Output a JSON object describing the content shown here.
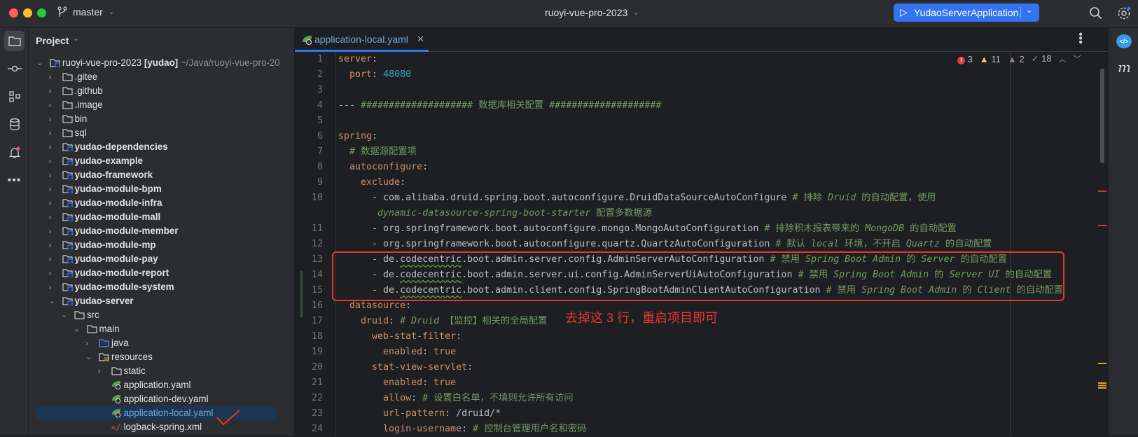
{
  "titlebar": {
    "branch": "master",
    "project": "ruoyi-vue-pro-2023",
    "run_config": "YudaoServerApplication"
  },
  "project_panel": {
    "title": "Project",
    "rows": [
      {
        "label": "ruoyi-vue-pro-2023",
        "suffix": "[yudao]",
        "path": "~/Java/ruoyi-vue-pro-20",
        "depth": 0,
        "chev": "down",
        "icon": "module"
      },
      {
        "label": ".gitee",
        "depth": 1,
        "chev": "right",
        "icon": "folder"
      },
      {
        "label": ".github",
        "depth": 1,
        "chev": "right",
        "icon": "folder"
      },
      {
        "label": ".image",
        "depth": 1,
        "chev": "right",
        "icon": "folder"
      },
      {
        "label": "bin",
        "depth": 1,
        "chev": "right",
        "icon": "folder"
      },
      {
        "label": "sql",
        "depth": 1,
        "chev": "right",
        "icon": "folder"
      },
      {
        "label": "yudao-dependencies",
        "depth": 1,
        "chev": "right",
        "icon": "module",
        "bold": true
      },
      {
        "label": "yudao-example",
        "depth": 1,
        "chev": "right",
        "icon": "module",
        "bold": true
      },
      {
        "label": "yudao-framework",
        "depth": 1,
        "chev": "right",
        "icon": "module",
        "bold": true
      },
      {
        "label": "yudao-module-bpm",
        "depth": 1,
        "chev": "right",
        "icon": "module",
        "bold": true
      },
      {
        "label": "yudao-module-infra",
        "depth": 1,
        "chev": "right",
        "icon": "module",
        "bold": true
      },
      {
        "label": "yudao-module-mall",
        "depth": 1,
        "chev": "right",
        "icon": "module",
        "bold": true
      },
      {
        "label": "yudao-module-member",
        "depth": 1,
        "chev": "right",
        "icon": "module",
        "bold": true
      },
      {
        "label": "yudao-module-mp",
        "depth": 1,
        "chev": "right",
        "icon": "module",
        "bold": true
      },
      {
        "label": "yudao-module-pay",
        "depth": 1,
        "chev": "right",
        "icon": "module",
        "bold": true
      },
      {
        "label": "yudao-module-report",
        "depth": 1,
        "chev": "right",
        "icon": "module",
        "bold": true
      },
      {
        "label": "yudao-module-system",
        "depth": 1,
        "chev": "right",
        "icon": "module",
        "bold": true
      },
      {
        "label": "yudao-server",
        "depth": 1,
        "chev": "down",
        "icon": "module",
        "bold": true
      },
      {
        "label": "src",
        "depth": 2,
        "chev": "down",
        "icon": "folder"
      },
      {
        "label": "main",
        "depth": 3,
        "chev": "down",
        "icon": "folder"
      },
      {
        "label": "java",
        "depth": 4,
        "chev": "right",
        "icon": "java-folder"
      },
      {
        "label": "resources",
        "depth": 4,
        "chev": "down",
        "icon": "resources-folder"
      },
      {
        "label": "static",
        "depth": 5,
        "chev": "right",
        "icon": "folder"
      },
      {
        "label": "application.yaml",
        "depth": 5,
        "icon": "yaml"
      },
      {
        "label": "application-dev.yaml",
        "depth": 5,
        "icon": "yaml"
      },
      {
        "label": "application-local.yaml",
        "depth": 5,
        "icon": "yaml",
        "selected": true
      },
      {
        "label": "logback-spring.xml",
        "depth": 5,
        "icon": "xml"
      }
    ]
  },
  "editor": {
    "tab": "application-local.yaml",
    "inspections": {
      "errors": "3",
      "warnings": "11",
      "weak_warnings": "2",
      "typos": "18"
    },
    "lines": [
      {
        "n": "1",
        "s": [
          [
            "k",
            "server"
          ],
          [
            "p",
            ":"
          ]
        ]
      },
      {
        "n": "2",
        "s": [
          [
            "t",
            "  "
          ],
          [
            "k",
            "port"
          ],
          [
            "p",
            ": "
          ],
          [
            "n",
            "48080"
          ]
        ]
      },
      {
        "n": "3",
        "s": []
      },
      {
        "n": "4",
        "s": [
          [
            "t",
            "--- "
          ],
          [
            "cz",
            "#################### 数据库相关配置 ####################"
          ]
        ]
      },
      {
        "n": "5",
        "s": []
      },
      {
        "n": "6",
        "s": [
          [
            "k",
            "spring"
          ],
          [
            "p",
            ":"
          ]
        ]
      },
      {
        "n": "7",
        "s": [
          [
            "t",
            "  "
          ],
          [
            "cz",
            "# 数据源配置项"
          ]
        ]
      },
      {
        "n": "8",
        "s": [
          [
            "t",
            "  "
          ],
          [
            "k",
            "autoconfigure"
          ],
          [
            "p",
            ":"
          ]
        ]
      },
      {
        "n": "9",
        "s": [
          [
            "t",
            "    "
          ],
          [
            "k",
            "exclude"
          ],
          [
            "p",
            ":"
          ]
        ]
      },
      {
        "n": "10",
        "s": [
          [
            "t",
            "      - com.alibaba.druid.spring.boot.autoconfigure.DruidDataSourceAutoConfigure "
          ],
          [
            "cz",
            "# 排除 "
          ],
          [
            "c",
            "Druid"
          ],
          [
            "cz",
            " 的自动配置，使用"
          ]
        ]
      },
      {
        "n": "",
        "s": [
          [
            "t",
            "       "
          ],
          [
            "c",
            "dynamic-datasource-spring-boot-starter"
          ],
          [
            "cz",
            " 配置多数据源"
          ]
        ]
      },
      {
        "n": "11",
        "s": [
          [
            "t",
            "      - org.springframework.boot.autoconfigure.mongo.MongoAutoConfiguration "
          ],
          [
            "cz",
            "# 排除积木报表带来的 "
          ],
          [
            "c",
            "MongoDB"
          ],
          [
            "cz",
            " 的自动配置"
          ]
        ]
      },
      {
        "n": "12",
        "s": [
          [
            "t",
            "      - org.springframework.boot.autoconfigure.quartz.QuartzAutoConfiguration "
          ],
          [
            "cz",
            "# 默认 "
          ],
          [
            "c",
            "local"
          ],
          [
            "cz",
            " 环境，不开启 "
          ],
          [
            "c",
            "Quartz"
          ],
          [
            "cz",
            " 的自动配置"
          ]
        ]
      },
      {
        "n": "13",
        "s": [
          [
            "t",
            "      - de."
          ],
          [
            "sq",
            "codecentric"
          ],
          [
            "t",
            ".boot.admin.server.config.AdminServerAutoConfiguration "
          ],
          [
            "cz",
            "# 禁用 "
          ],
          [
            "c",
            "Spring Boot Admin"
          ],
          [
            "cz",
            " 的 "
          ],
          [
            "c",
            "Server"
          ],
          [
            "cz",
            " 的自动配置"
          ]
        ]
      },
      {
        "n": "14",
        "s": [
          [
            "t",
            "      - de."
          ],
          [
            "sq",
            "codecentric"
          ],
          [
            "t",
            ".boot.admin.server.ui.config.AdminServerUiAutoConfiguration "
          ],
          [
            "cz",
            "# 禁用 "
          ],
          [
            "c",
            "Spring Boot Admin"
          ],
          [
            "cz",
            " 的 "
          ],
          [
            "c",
            "Server UI"
          ],
          [
            "cz",
            " 的自动配置"
          ]
        ]
      },
      {
        "n": "15",
        "s": [
          [
            "t",
            "      - de."
          ],
          [
            "sq",
            "codecentric"
          ],
          [
            "t",
            ".boot.admin.client.config.SpringBootAdminClientAutoConfiguration "
          ],
          [
            "cz",
            "# 禁用 "
          ],
          [
            "c",
            "Spring Boot Admin"
          ],
          [
            "cz",
            " 的 "
          ],
          [
            "c",
            "Client"
          ],
          [
            "cz",
            " 的自动配置"
          ]
        ]
      },
      {
        "n": "16",
        "s": [
          [
            "t",
            "  "
          ],
          [
            "k",
            "datasource"
          ],
          [
            "p",
            ":"
          ]
        ]
      },
      {
        "n": "17",
        "s": [
          [
            "t",
            "    "
          ],
          [
            "k",
            "druid"
          ],
          [
            "p",
            ": "
          ],
          [
            "c",
            "# Druid"
          ],
          [
            "cz",
            " 【监控】相关的全局配置"
          ]
        ]
      },
      {
        "n": "18",
        "s": [
          [
            "t",
            "      "
          ],
          [
            "k",
            "web-stat-filter"
          ],
          [
            "p",
            ":"
          ]
        ]
      },
      {
        "n": "19",
        "s": [
          [
            "t",
            "        "
          ],
          [
            "k",
            "enabled"
          ],
          [
            "p",
            ": "
          ],
          [
            "b",
            "true"
          ]
        ]
      },
      {
        "n": "20",
        "s": [
          [
            "t",
            "      "
          ],
          [
            "k",
            "stat-view-servlet"
          ],
          [
            "p",
            ":"
          ]
        ]
      },
      {
        "n": "21",
        "s": [
          [
            "t",
            "        "
          ],
          [
            "k",
            "enabled"
          ],
          [
            "p",
            ": "
          ],
          [
            "b",
            "true"
          ]
        ]
      },
      {
        "n": "22",
        "s": [
          [
            "t",
            "        "
          ],
          [
            "k",
            "allow"
          ],
          [
            "p",
            ": "
          ],
          [
            "cz",
            "# 设置白名单，不填则允许所有访问"
          ]
        ]
      },
      {
        "n": "23",
        "s": [
          [
            "t",
            "        "
          ],
          [
            "k",
            "url-pattern"
          ],
          [
            "p",
            ": "
          ],
          [
            "t",
            "/druid/*"
          ]
        ]
      },
      {
        "n": "24",
        "s": [
          [
            "t",
            "        "
          ],
          [
            "k",
            "login-username"
          ],
          [
            "p",
            ": "
          ],
          [
            "cz",
            "# 控制台管理用户名和密码"
          ]
        ]
      }
    ]
  },
  "annotation": {
    "text": "去掉这 3 行，重启项目即可",
    "color": "#e8372c"
  },
  "colors": {
    "accent": "#3574f0",
    "selection": "#1c3552",
    "annotation": "#e8372c"
  }
}
